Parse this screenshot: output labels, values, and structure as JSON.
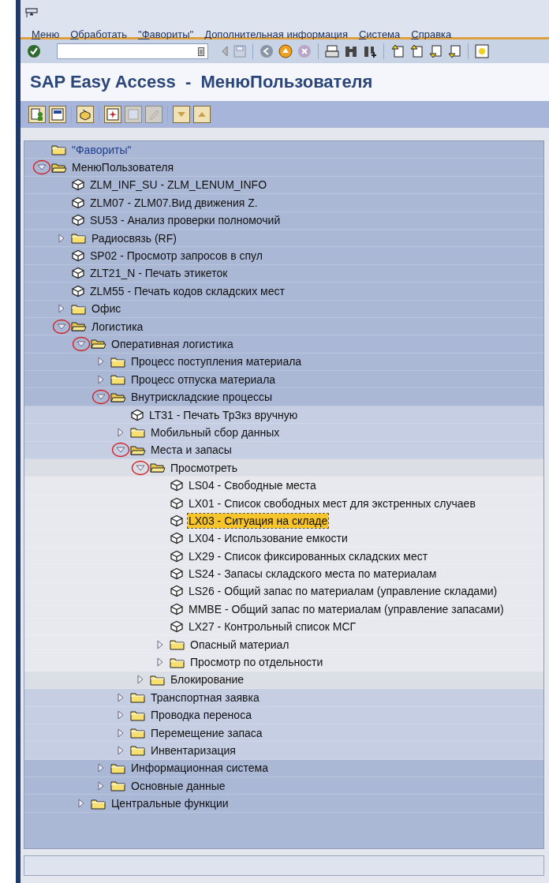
{
  "menu_bar": [
    "Меню",
    "Обработать",
    "\"Фавориты\"",
    "Дополнительная информация",
    "Система",
    "Справка"
  ],
  "title": "SAP Easy Access  -  МенюПользователя",
  "tree": [
    {
      "kind": "favorites",
      "text": "\"Фавориты\"",
      "selected": false
    },
    {
      "kind": "folder",
      "text": "МенюПользователя",
      "expanded": true,
      "selected": false,
      "children": [
        {
          "kind": "transaction",
          "text": "ZLM_INF_SU - ZLM_LENUM_INFO",
          "selected": false
        },
        {
          "kind": "transaction",
          "text": "ZLM07 - ZLM07.Вид движения Z.",
          "selected": false
        },
        {
          "kind": "transaction",
          "text": "SU53 - Анализ проверки полномочий",
          "selected": false
        },
        {
          "kind": "folder",
          "text": "Радиосвязь (RF)",
          "expanded": false,
          "selected": false
        },
        {
          "kind": "transaction",
          "text": "SP02 - Просмотр запросов в спул",
          "selected": false
        },
        {
          "kind": "transaction",
          "text": "ZLT21_N - Печать этикеток",
          "selected": false
        },
        {
          "kind": "transaction",
          "text": "ZLM55 - Печать кодов складских мест",
          "selected": false
        },
        {
          "kind": "folder",
          "text": "Офис",
          "expanded": false,
          "selected": false
        },
        {
          "kind": "folder",
          "text": "Логистика",
          "expanded": true,
          "selected": false,
          "children": [
            {
              "kind": "folder",
              "text": "Оперативная логистика",
              "expanded": true,
              "selected": false,
              "children": [
                {
                  "kind": "folder",
                  "text": "Процесс поступления материала",
                  "expanded": false,
                  "selected": false
                },
                {
                  "kind": "folder",
                  "text": "Процесс отпуска материала",
                  "expanded": false,
                  "selected": false
                },
                {
                  "kind": "folder",
                  "text": "Внутрискладские процессы",
                  "expanded": true,
                  "selected": false,
                  "children": [
                    {
                      "kind": "transaction",
                      "text": "LT31 - Печать ТрЗкз вручную",
                      "selected": false
                    },
                    {
                      "kind": "folder",
                      "text": "Мобильный сбор данных",
                      "expanded": false,
                      "selected": false
                    },
                    {
                      "kind": "folder",
                      "text": "Места и запасы",
                      "expanded": true,
                      "selected": false,
                      "children": [
                        {
                          "kind": "folder",
                          "text": "Просмотреть",
                          "expanded": true,
                          "selected": false,
                          "children": [
                            {
                              "kind": "transaction",
                              "text": "LS04 - Свободные места",
                              "selected": false
                            },
                            {
                              "kind": "transaction",
                              "text": "LX01 - Список свободных мест для экстренных случаев",
                              "selected": false
                            },
                            {
                              "kind": "transaction",
                              "text": "LX03 - Ситуация на складе",
                              "selected": true
                            },
                            {
                              "kind": "transaction",
                              "text": "LX04 - Использование емкости",
                              "selected": false
                            },
                            {
                              "kind": "transaction",
                              "text": "LX29 - Список фиксированных складских мест",
                              "selected": false
                            },
                            {
                              "kind": "transaction",
                              "text": "LS24 - Запасы складского места по материалам",
                              "selected": false
                            },
                            {
                              "kind": "transaction",
                              "text": "LS26 - Общий запас по материалам (управление складами)",
                              "selected": false
                            },
                            {
                              "kind": "transaction",
                              "text": "MMBE - Общий запас по материалам (управление запасами)",
                              "selected": false
                            },
                            {
                              "kind": "transaction",
                              "text": "LX27 - Контрольный список МСГ",
                              "selected": false
                            },
                            {
                              "kind": "folder",
                              "text": "Опасный материал",
                              "expanded": false,
                              "selected": false
                            },
                            {
                              "kind": "folder",
                              "text": "Просмотр по отдельности",
                              "expanded": false,
                              "selected": false
                            }
                          ]
                        },
                        {
                          "kind": "folder",
                          "text": "Блокирование",
                          "expanded": false,
                          "selected": false
                        }
                      ]
                    },
                    {
                      "kind": "folder",
                      "text": "Транспортная заявка",
                      "expanded": false,
                      "selected": false
                    },
                    {
                      "kind": "folder",
                      "text": "Проводка переноса",
                      "expanded": false,
                      "selected": false
                    },
                    {
                      "kind": "folder",
                      "text": "Перемещение запаса",
                      "expanded": false,
                      "selected": false
                    },
                    {
                      "kind": "folder",
                      "text": "Инвентаризация",
                      "expanded": false,
                      "selected": false
                    }
                  ]
                },
                {
                  "kind": "folder",
                  "text": "Информационная система",
                  "expanded": false,
                  "selected": false
                },
                {
                  "kind": "folder",
                  "text": "Основные данные",
                  "expanded": false,
                  "selected": false
                }
              ]
            },
            {
              "kind": "folder",
              "text": "Центральные функции",
              "expanded": false,
              "selected": false
            }
          ]
        }
      ]
    }
  ]
}
